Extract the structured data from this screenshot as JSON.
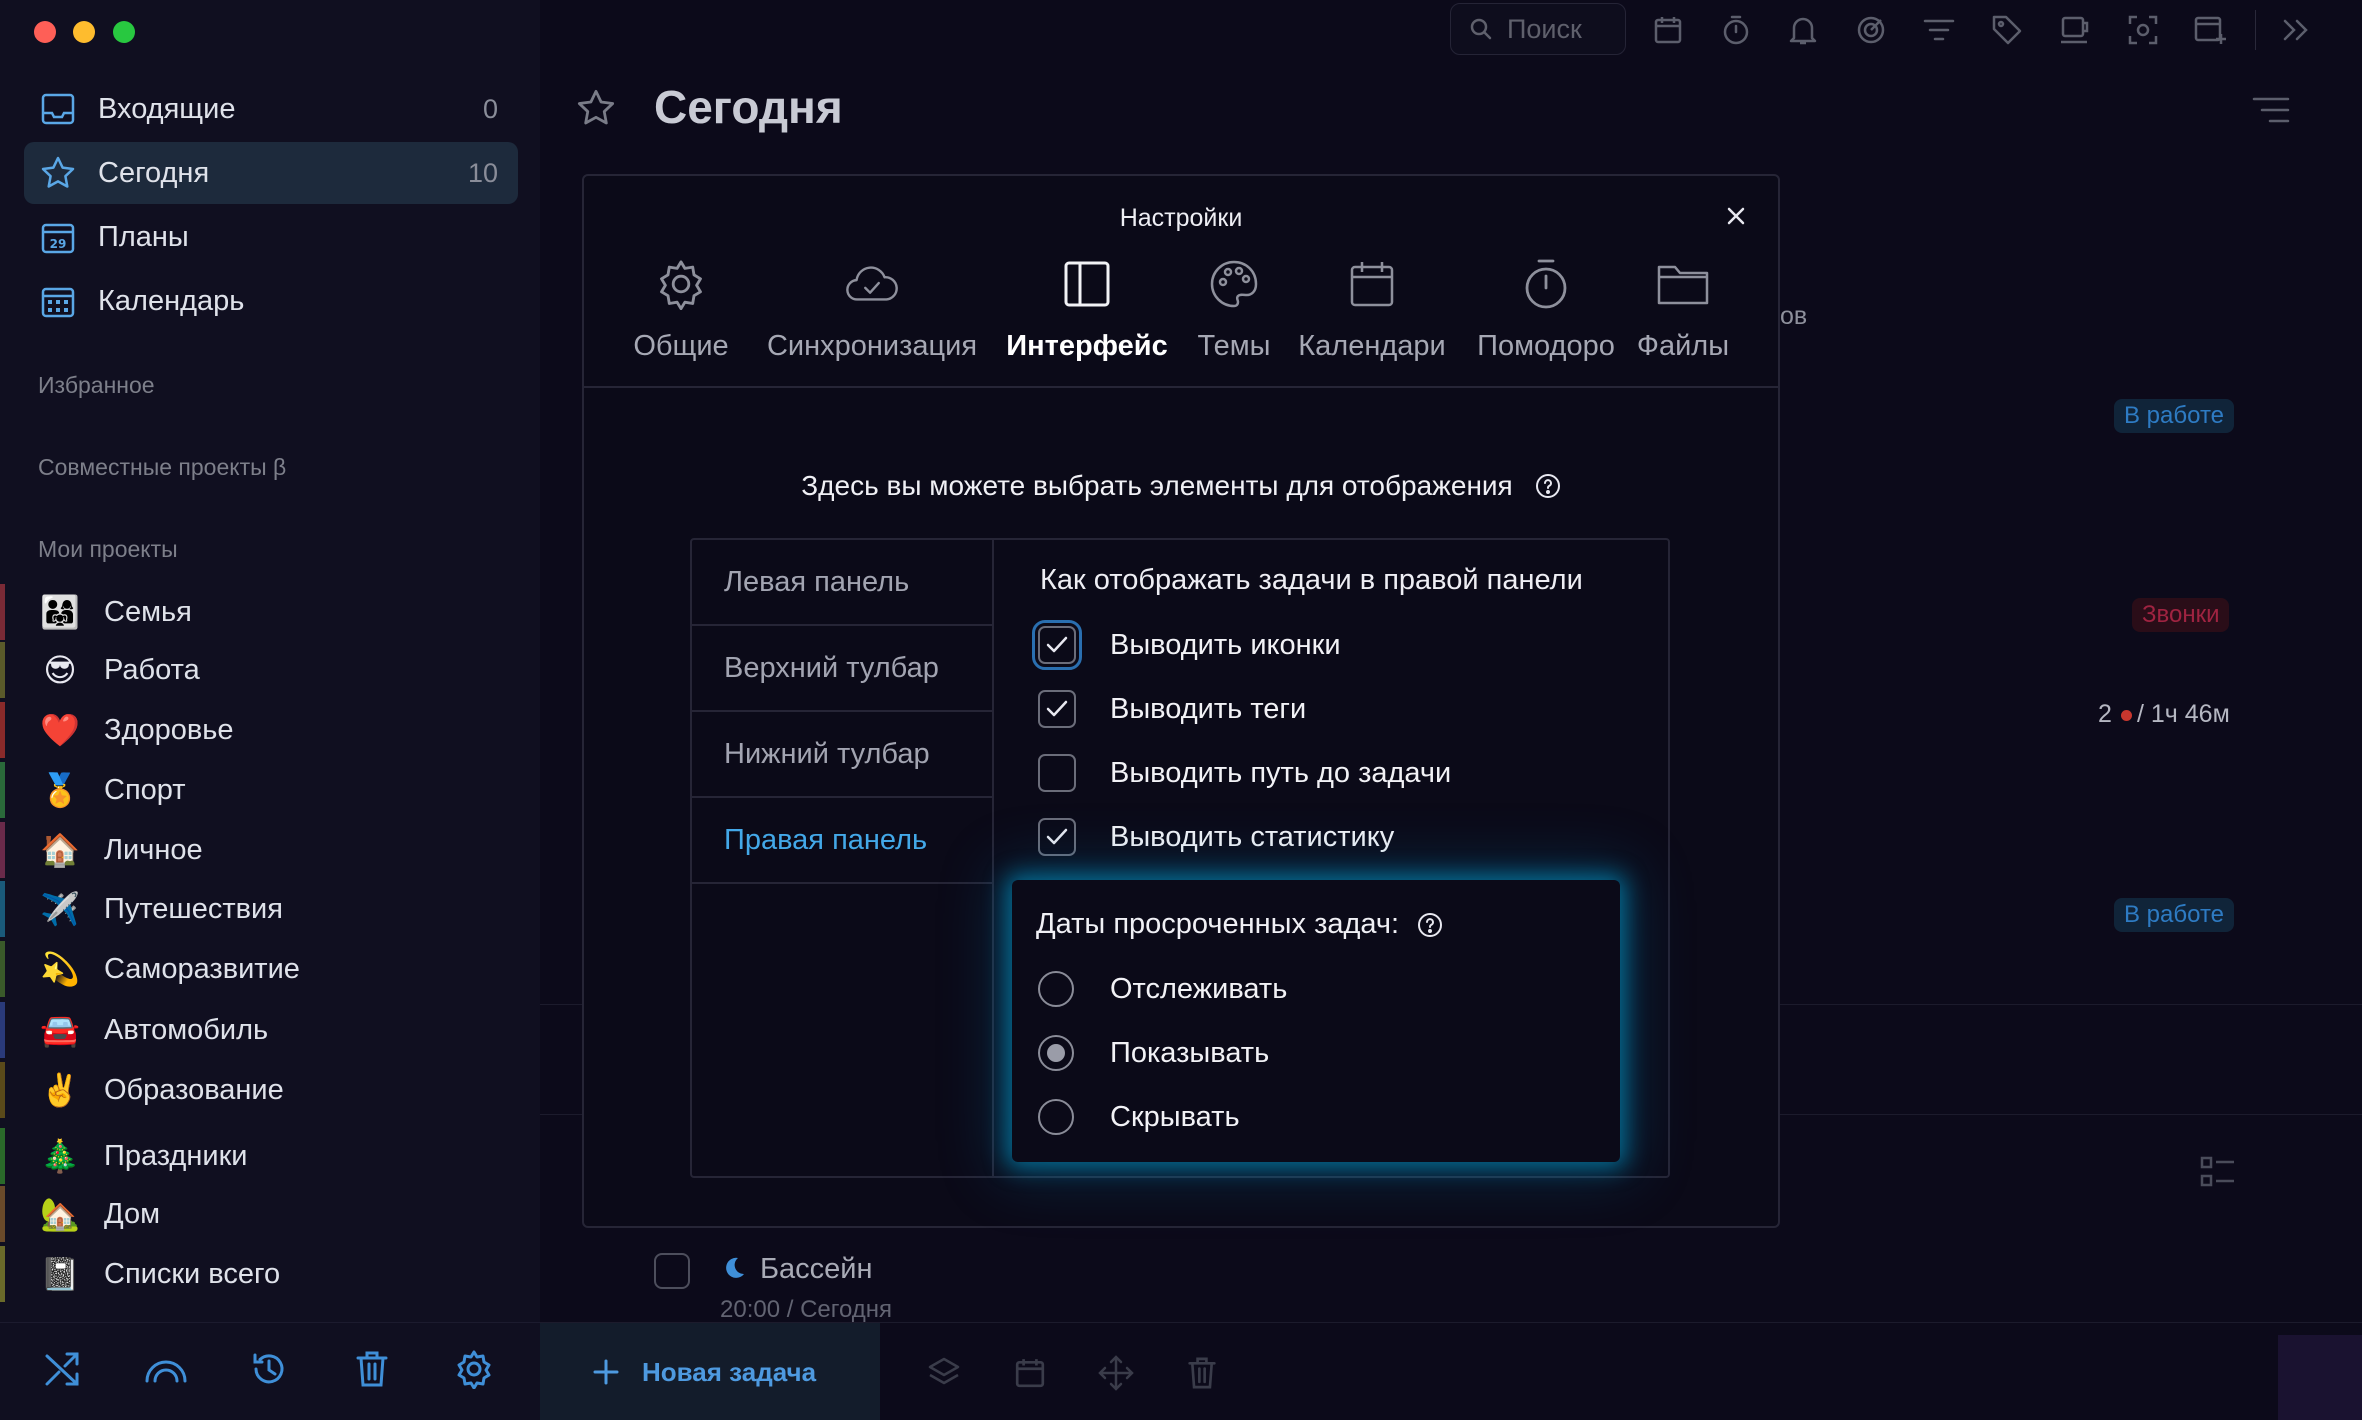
{
  "sidebar": {
    "nav": [
      {
        "label": "Входящие",
        "count": "0",
        "icon": "inbox-icon"
      },
      {
        "label": "Сегодня",
        "count": "10",
        "icon": "star-icon"
      },
      {
        "label": "Планы",
        "count": "",
        "icon": "calendar-29-icon"
      },
      {
        "label": "Календарь",
        "count": "",
        "icon": "calendar-grid-icon"
      }
    ],
    "sections": {
      "favorites": "Избранное",
      "shared": "Совместные проекты β",
      "my_projects": "Мои проекты"
    },
    "projects": [
      {
        "emoji": "👨‍👩‍👧",
        "label": "Семья",
        "color": "#7a2a36"
      },
      {
        "emoji": "😎",
        "label": "Работа",
        "color": "#5a5a2a"
      },
      {
        "emoji": "❤️",
        "label": "Здоровье",
        "color": "#8a2a2a"
      },
      {
        "emoji": "🏅",
        "label": "Спорт",
        "color": "#2a6a3a"
      },
      {
        "emoji": "🏠",
        "label": "Личное",
        "color": "#6a2a4a"
      },
      {
        "emoji": "✈️",
        "label": "Путешествия",
        "color": "#1a5a7a"
      },
      {
        "emoji": "💫",
        "label": "Саморазвитие",
        "color": "#3a5a2a"
      },
      {
        "emoji": "🚘",
        "label": "Автомобиль",
        "color": "#2a3a7a"
      },
      {
        "emoji": "✌️",
        "label": "Образование",
        "color": "#5a4a1a"
      },
      {
        "emoji": "🎄",
        "label": "Праздники",
        "color": "#2a6a2a"
      },
      {
        "emoji": "🏡",
        "label": "Дом",
        "color": "#6a4a2a"
      },
      {
        "emoji": "📓",
        "label": "Списки всего",
        "color": "#6a6a2a"
      }
    ]
  },
  "toolbar": {
    "search_placeholder": "Поиск"
  },
  "main": {
    "title": "Сегодня",
    "background": {
      "text_ov": "ов",
      "badge_1": "В работе",
      "badge_2": "Звонки",
      "pomodoro_count": "2",
      "pomodoro_time": "/ 1ч 46м",
      "badge_3": "В работе"
    },
    "task": {
      "title": "Бассейн",
      "subtitle": "20:00 / Сегодня"
    },
    "new_task_label": "Новая задача"
  },
  "modal": {
    "title": "Настройки",
    "tabs": [
      {
        "label": "Общие",
        "icon": "gear-icon"
      },
      {
        "label": "Синхронизация",
        "icon": "cloud-sync-icon"
      },
      {
        "label": "Интерфейс",
        "icon": "layout-panel-icon"
      },
      {
        "label": "Темы",
        "icon": "palette-icon"
      },
      {
        "label": "Календари",
        "icon": "calendar-icon"
      },
      {
        "label": "Помодоро",
        "icon": "timer-icon"
      },
      {
        "label": "Файлы",
        "icon": "folder-icon"
      }
    ],
    "active_tab": "Интерфейс",
    "subtitle": "Здесь вы можете выбрать элементы для отображения",
    "left_menu": [
      "Левая панель",
      "Верхний тулбар",
      "Нижний тулбар",
      "Правая панель"
    ],
    "active_left": "Правая панель",
    "right_heading": "Как отображать задачи в правой панели",
    "options": [
      {
        "label": "Выводить иконки",
        "checked": true
      },
      {
        "label": "Выводить теги",
        "checked": true
      },
      {
        "label": "Выводить путь до задачи",
        "checked": false
      },
      {
        "label": "Выводить статистику",
        "checked": true
      }
    ],
    "overdue": {
      "heading": "Даты просроченных задач:",
      "choices": [
        {
          "label": "Отслеживать",
          "selected": false
        },
        {
          "label": "Показывать",
          "selected": true
        },
        {
          "label": "Скрывать",
          "selected": false
        }
      ]
    }
  },
  "colors": {
    "accent": "#43a8e8",
    "glow": "#00aadc",
    "active_nav_bg": "#1d2a3c"
  }
}
